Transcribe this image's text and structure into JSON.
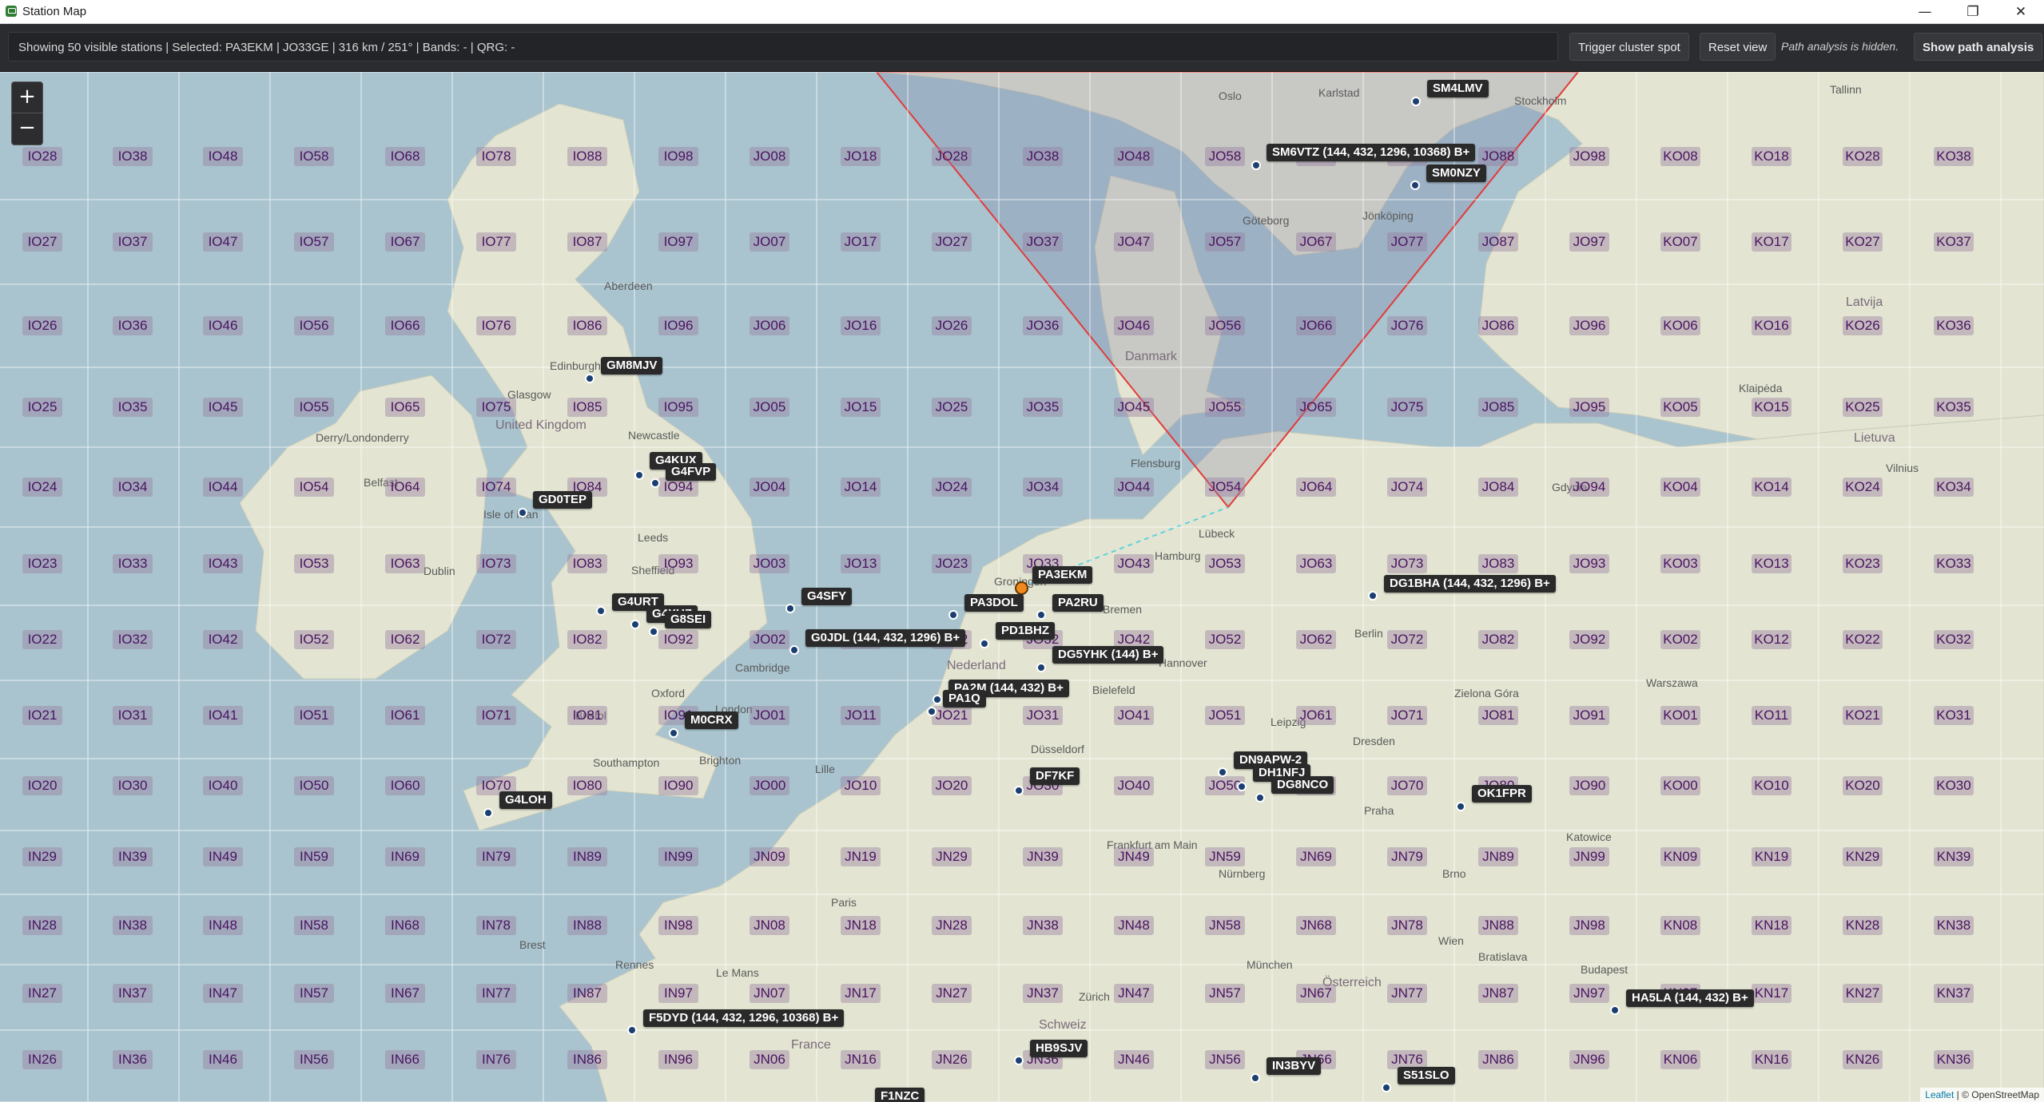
{
  "window": {
    "title": "Station Map",
    "controls": [
      "—",
      "❐",
      "✕"
    ]
  },
  "toolbar": {
    "status": "Showing 50 visible stations | Selected: PA3EKM | JO33GE | 316 km / 251° | Bands: - | QRG: -",
    "trigger_label": "Trigger cluster spot",
    "reset_label": "Reset view",
    "path_note": "Path analysis is hidden.",
    "show_path_label": "Show path analysis"
  },
  "map": {
    "zoom_in": "+",
    "zoom_out": "−",
    "attribution_leaflet": "Leaflet",
    "attribution_osm": "| © OpenStreetMap",
    "colors": {
      "sea": "#a9c4cf",
      "land": "#e4e6d3",
      "grid_line": "#ffffff",
      "grid_label": "#4a1360",
      "beam": "#e23b3b",
      "selected": "#f08a1f"
    },
    "grid_rows": [
      [
        "IO28",
        "IO38",
        "IO48",
        "IO58",
        "IO68",
        "IO78",
        "IO88",
        "IO98",
        "JO08",
        "JO18",
        "JO28",
        "JO38",
        "JO48",
        "JO58",
        "JO68",
        "JO78",
        "JO88",
        "JO98",
        "KO08",
        "KO18",
        "KO28",
        "KO38"
      ],
      [
        "IO27",
        "IO37",
        "IO47",
        "IO57",
        "IO67",
        "IO77",
        "IO87",
        "IO97",
        "JO07",
        "JO17",
        "JO27",
        "JO37",
        "JO47",
        "JO57",
        "JO67",
        "JO77",
        "JO87",
        "JO97",
        "KO07",
        "KO17",
        "KO27",
        "KO37"
      ],
      [
        "IO26",
        "IO36",
        "IO46",
        "IO56",
        "IO66",
        "IO76",
        "IO86",
        "IO96",
        "JO06",
        "JO16",
        "JO26",
        "JO36",
        "JO46",
        "JO56",
        "JO66",
        "JO76",
        "JO86",
        "JO96",
        "KO06",
        "KO16",
        "KO26",
        "KO36"
      ],
      [
        "IO25",
        "IO35",
        "IO45",
        "IO55",
        "IO65",
        "IO75",
        "IO85",
        "IO95",
        "JO05",
        "JO15",
        "JO25",
        "JO35",
        "JO45",
        "JO55",
        "JO65",
        "JO75",
        "JO85",
        "JO95",
        "KO05",
        "KO15",
        "KO25",
        "KO35"
      ],
      [
        "IO24",
        "IO34",
        "IO44",
        "IO54",
        "IO64",
        "IO74",
        "IO84",
        "IO94",
        "JO04",
        "JO14",
        "JO24",
        "JO34",
        "JO44",
        "JO54",
        "JO64",
        "JO74",
        "JO84",
        "JO94",
        "KO04",
        "KO14",
        "KO24",
        "KO34"
      ],
      [
        "IO23",
        "IO33",
        "IO43",
        "IO53",
        "IO63",
        "IO73",
        "IO83",
        "IO93",
        "JO03",
        "JO13",
        "JO23",
        "JO33",
        "JO43",
        "JO53",
        "JO63",
        "JO73",
        "JO83",
        "JO93",
        "KO03",
        "KO13",
        "KO23",
        "KO33"
      ],
      [
        "IO22",
        "IO32",
        "IO42",
        "IO52",
        "IO62",
        "IO72",
        "IO82",
        "IO92",
        "JO02",
        "JO12",
        "JO22",
        "JO32",
        "JO42",
        "JO52",
        "JO62",
        "JO72",
        "JO82",
        "JO92",
        "KO02",
        "KO12",
        "KO22",
        "KO32"
      ],
      [
        "IO21",
        "IO31",
        "IO41",
        "IO51",
        "IO61",
        "IO71",
        "IO81",
        "IO91",
        "JO01",
        "JO11",
        "JO21",
        "JO31",
        "JO41",
        "JO51",
        "JO61",
        "JO71",
        "JO81",
        "JO91",
        "KO01",
        "KO11",
        "KO21",
        "KO31"
      ],
      [
        "IO20",
        "IO30",
        "IO40",
        "IO50",
        "IO60",
        "IO70",
        "IO80",
        "IO90",
        "JO00",
        "JO10",
        "JO20",
        "JO30",
        "JO40",
        "JO50",
        "JO60",
        "JO70",
        "JO80",
        "JO90",
        "KO00",
        "KO10",
        "KO20",
        "KO30"
      ],
      [
        "IN29",
        "IN39",
        "IN49",
        "IN59",
        "IN69",
        "IN79",
        "IN89",
        "IN99",
        "JN09",
        "JN19",
        "JN29",
        "JN39",
        "JN49",
        "JN59",
        "JN69",
        "JN79",
        "JN89",
        "JN99",
        "KN09",
        "KN19",
        "KN29",
        "KN39"
      ],
      [
        "IN28",
        "IN38",
        "IN48",
        "IN58",
        "IN68",
        "IN78",
        "IN88",
        "IN98",
        "JN08",
        "JN18",
        "JN28",
        "JN38",
        "JN48",
        "JN58",
        "JN68",
        "JN78",
        "JN88",
        "JN98",
        "KN08",
        "KN18",
        "KN28",
        "KN38"
      ],
      [
        "IN27",
        "IN37",
        "IN47",
        "IN57",
        "IN67",
        "IN77",
        "IN87",
        "IN97",
        "JN07",
        "JN17",
        "JN27",
        "JN37",
        "JN47",
        "JN57",
        "JN67",
        "JN77",
        "JN87",
        "JN97",
        "KN07",
        "KN17",
        "KN27",
        "KN37"
      ],
      [
        "IN26",
        "IN36",
        "IN46",
        "IN56",
        "IN66",
        "IN76",
        "IN86",
        "IN96",
        "JN06",
        "JN16",
        "JN26",
        "JN36",
        "JN46",
        "JN56",
        "JN66",
        "JN76",
        "JN86",
        "JN96",
        "KN06",
        "KN16",
        "KN26",
        "KN36"
      ]
    ],
    "stations": [
      {
        "call": "SM4LMV",
        "label": "SM4LMV"
      },
      {
        "call": "SM6VTZ",
        "label": "SM6VTZ (144, 432, 1296, 10368) B+"
      },
      {
        "call": "SM0NZY",
        "label": "SM0NZY"
      },
      {
        "call": "GM8MJV",
        "label": "GM8MJV"
      },
      {
        "call": "G4KUX",
        "label": "G4KUX"
      },
      {
        "call": "G4FVP",
        "label": "G4FVP"
      },
      {
        "call": "GD0TEP",
        "label": "GD0TEP"
      },
      {
        "call": "PA3EKM",
        "label": "PA3EKM",
        "selected": true
      },
      {
        "call": "G4SFY",
        "label": "G4SFY"
      },
      {
        "call": "PA3DOL",
        "label": "PA3DOL"
      },
      {
        "call": "PA2RU",
        "label": "PA2RU"
      },
      {
        "call": "DG1BHA",
        "label": "DG1BHA (144, 432, 1296) B+"
      },
      {
        "call": "G4URT",
        "label": "G4URT"
      },
      {
        "call": "G4XUZ",
        "label": "G4XUZ"
      },
      {
        "call": "G8SEI",
        "label": "G8SEI"
      },
      {
        "call": "G0JDL",
        "label": "G0JDL (144, 432, 1296) B+"
      },
      {
        "call": "PD1BHZ",
        "label": "PD1BHZ"
      },
      {
        "call": "DG5YHK",
        "label": "DG5YHK (144) B+"
      },
      {
        "call": "PA2M",
        "label": "PA2M (144, 432) B+"
      },
      {
        "call": "PA1Q",
        "label": "PA1Q"
      },
      {
        "call": "M0CRX",
        "label": "M0CRX"
      },
      {
        "call": "DN9APW-2",
        "label": "DN9APW-2"
      },
      {
        "call": "DH1NFJ",
        "label": "DH1NFJ"
      },
      {
        "call": "DG8NCO",
        "label": "DG8NCO"
      },
      {
        "call": "DF7KF",
        "label": "DF7KF"
      },
      {
        "call": "OK1FPR",
        "label": "OK1FPR"
      },
      {
        "call": "G4LOH",
        "label": "G4LOH"
      },
      {
        "call": "HA5LA",
        "label": "HA5LA (144, 432) B+"
      },
      {
        "call": "F5DYD",
        "label": "F5DYD (144, 432, 1296, 10368) B+"
      },
      {
        "call": "HB9SJV",
        "label": "HB9SJV"
      },
      {
        "call": "IN3BYV",
        "label": "IN3BYV"
      },
      {
        "call": "S51SLO",
        "label": "S51SLO"
      },
      {
        "call": "F1NZC",
        "label": "F1NZC"
      }
    ],
    "places": [
      "Oslo",
      "Karlstad",
      "Stockholm",
      "Tallinn",
      "Göteborg",
      "Jönköping",
      "Aberdeen",
      "Danmark",
      "Edinburgh",
      "Glasgow",
      "Latvija",
      "United Kingdom",
      "Klaipėda",
      "Lietuva",
      "Vilnius",
      "Derry/Londonderry",
      "Belfast",
      "Newcastle",
      "Flensburg",
      "Hamburg",
      "Lübeck",
      "Gdynia",
      "Isle of Man",
      "Leeds",
      "Dublin",
      "Sheffield",
      "Groningen",
      "Bremen",
      "Berlin",
      "Warszawa",
      "Cambridge",
      "Nederland",
      "Bielefeld",
      "Hannover",
      "Zielona Góra",
      "London",
      "Oxford",
      "Bristol",
      "Southampton",
      "Brighton",
      "Lille",
      "Düsseldorf",
      "Leipzig",
      "Dresden",
      "Praha",
      "Katowice",
      "Frankfurt am Main",
      "Nürnberg",
      "Brno",
      "Wien",
      "Bratislava",
      "Budapest",
      "Paris",
      "München",
      "Zürich",
      "Schweiz",
      "Österreich",
      "Brest",
      "Le Mans",
      "France",
      "Rennes"
    ]
  }
}
